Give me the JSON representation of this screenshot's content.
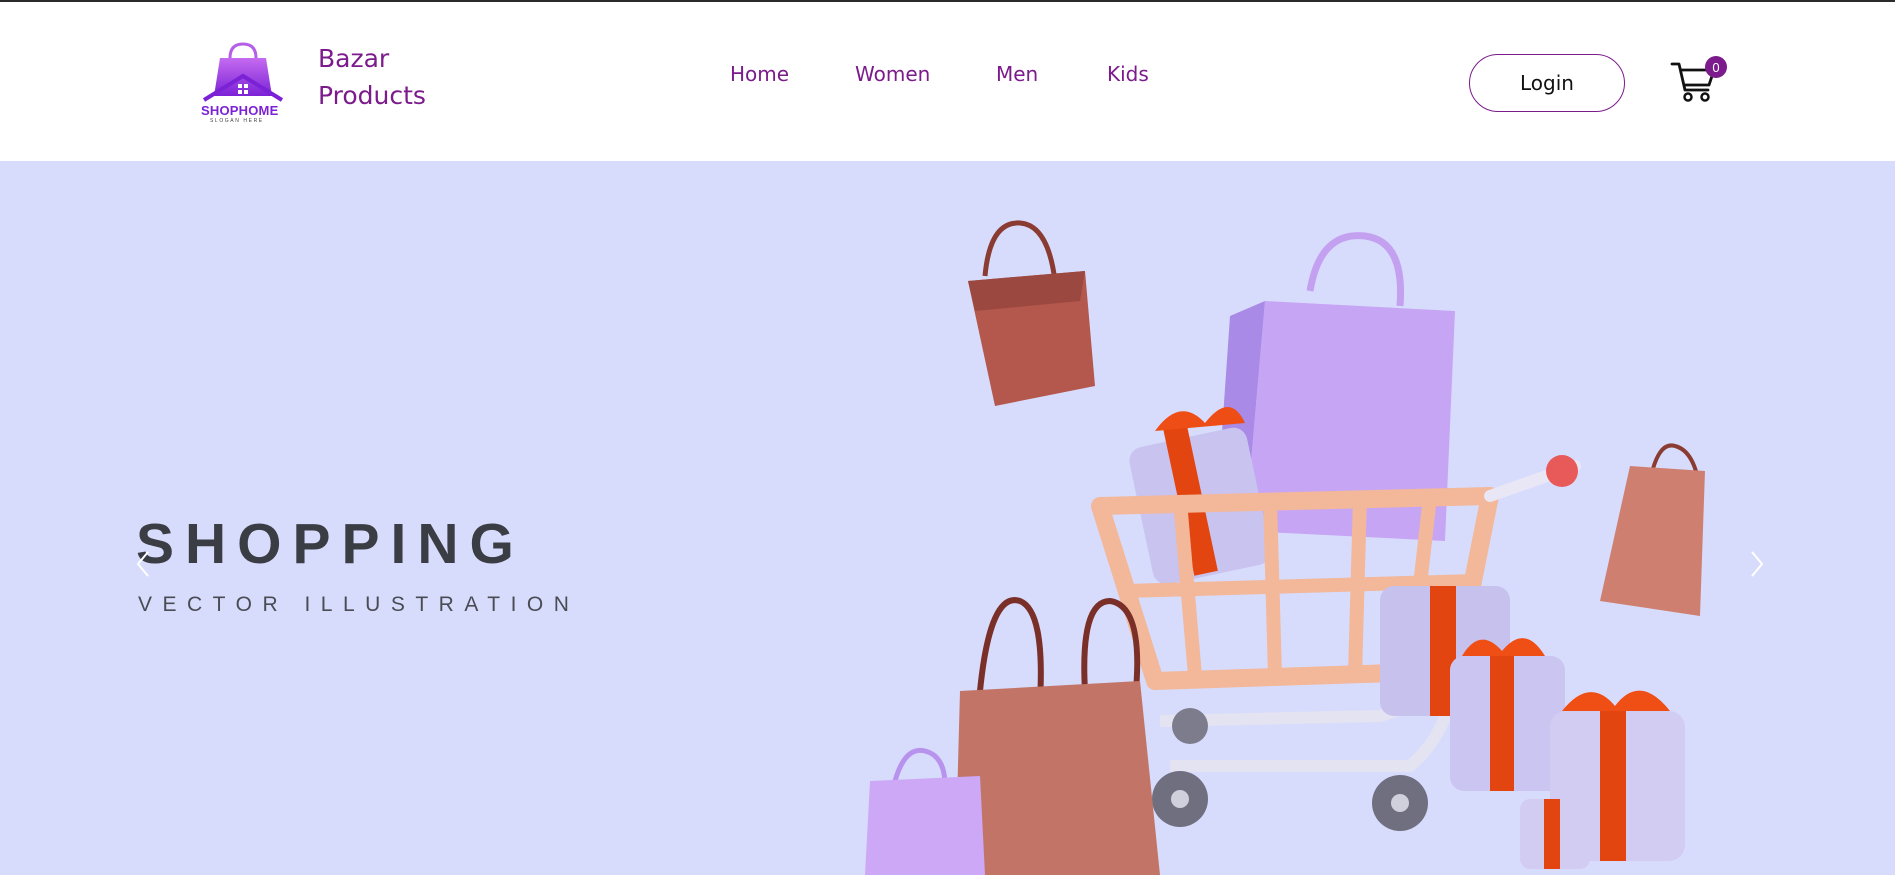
{
  "header": {
    "logo": {
      "text_shop": "SHOP",
      "text_home": "HOME",
      "slogan": "SLOGAN HERE",
      "icon": "shopping-bag-house-logo"
    },
    "brand_line1": "Bazar",
    "brand_line2": "Products",
    "nav": [
      {
        "label": "Home"
      },
      {
        "label": "Women"
      },
      {
        "label": "Men"
      },
      {
        "label": "Kids"
      }
    ],
    "login_label": "Login",
    "cart": {
      "icon": "shopping-cart-icon",
      "count": "0"
    }
  },
  "hero": {
    "title": "SHOPPING",
    "subtitle": "VECTOR ILLUSTRATION",
    "prev_icon": "chevron-left-icon",
    "next_icon": "chevron-right-icon",
    "illustration": "shopping-cart-with-bags-and-gifts"
  },
  "colors": {
    "brand": "#7b1b8c",
    "logo_purple": "#7b22d6",
    "hero_bg": "#d8dcfc",
    "hero_text": "#3b3d44"
  }
}
